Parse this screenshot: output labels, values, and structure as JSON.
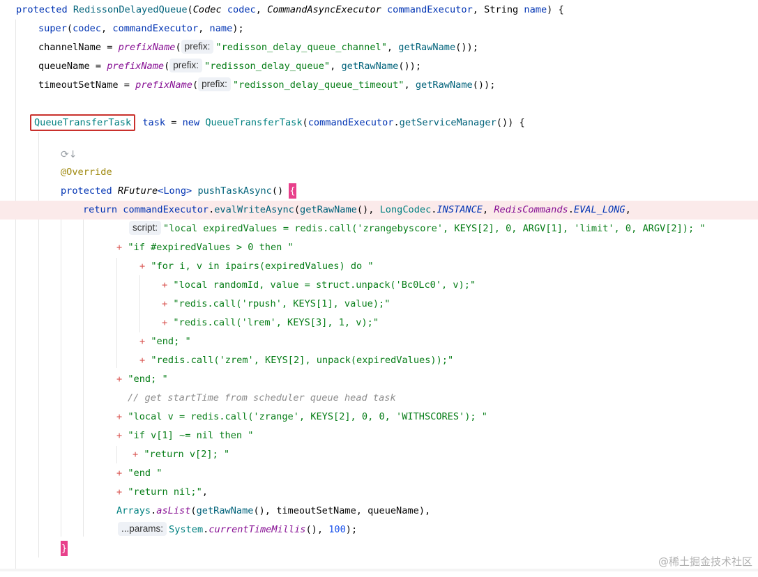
{
  "code": {
    "l1": {
      "kw": "protected ",
      "name": "RedissonDelayedQueue",
      "p1": "(",
      "t1": "Codec",
      "v1": " codec",
      "c1": ", ",
      "t2": "CommandAsyncExecutor",
      "v2": " commandExecutor",
      "c2": ", ",
      "t3": "String",
      "v3": " name",
      "tail": ") {"
    },
    "l2": {
      "kw": "super",
      "a": "(",
      "v1": "codec",
      "c1": ", ",
      "v2": "commandExecutor",
      "c2": ", ",
      "v3": "name",
      "tail": ");"
    },
    "l3": {
      "f": "channelName",
      "eq": " = ",
      "m": "prefixName",
      "p": "(",
      "hint": "prefix:",
      "s": "\"redisson_delay_queue_channel\"",
      "c": ", ",
      "m2": "getRawName",
      "tail": "());"
    },
    "l4": {
      "f": "queueName",
      "eq": " = ",
      "m": "prefixName",
      "p": "(",
      "hint": "prefix:",
      "s": "\"redisson_delay_queue\"",
      "c": ", ",
      "m2": "getRawName",
      "tail": "());"
    },
    "l5": {
      "f": "timeoutSetName",
      "eq": " = ",
      "m": "prefixName",
      "p": "(",
      "hint": "prefix:",
      "s": "\"redisson_delay_queue_timeout\"",
      "c": ", ",
      "m2": "getRawName",
      "tail": "());"
    },
    "l6": {
      "cls": "QueueTransferTask",
      "v": " task",
      "eq": " = ",
      "kw": "new ",
      "cls2": "QueueTransferTask",
      "p": "(",
      "v2": "commandExecutor",
      "dot": ".",
      "m": "getServiceManager",
      "tail": "()) {"
    },
    "l7": {
      "ann": "@Override"
    },
    "l8": {
      "kw": "protected ",
      "t": "RFuture",
      "gen": "<Long>",
      "sp": " ",
      "m": "pushTaskAsync",
      "p": "() ",
      "brace": "{"
    },
    "l9": {
      "kw": "return ",
      "v": "commandExecutor",
      "dot": ".",
      "m": "evalWriteAsync",
      "p": "(",
      "m2": "getRawName",
      "c": "(), ",
      "cls": "LongCodec",
      "dot2": ".",
      "st": "INSTANCE",
      "c2": ", ",
      "cls2": "RedisCommands",
      "dot3": ".",
      "st2": "EVAL_LONG",
      "tail": ","
    },
    "l10": {
      "hint": "script:",
      "s": "\"local expiredValues = redis.call('zrangebyscore', KEYS[2], 0, ARGV[1], 'limit', 0, ARGV[2]); \""
    },
    "l11": {
      "plus": "+ ",
      "s": "\"if #expiredValues > 0 then \""
    },
    "l12": {
      "plus": "+ ",
      "s": "\"for i, v in ipairs(expiredValues) do \""
    },
    "l13": {
      "plus": "+ ",
      "s": "\"local randomId, value = struct.unpack('Bc0Lc0', v);\""
    },
    "l14": {
      "plus": "+ ",
      "s": "\"redis.call('rpush', KEYS[1], value);\""
    },
    "l15": {
      "plus": "+ ",
      "s": "\"redis.call('lrem', KEYS[3], 1, v);\""
    },
    "l16": {
      "plus": "+ ",
      "s": "\"end; \""
    },
    "l17": {
      "plus": "+ ",
      "s": "\"redis.call('zrem', KEYS[2], unpack(expiredValues));\""
    },
    "l18": {
      "plus": "+ ",
      "s": "\"end; \""
    },
    "l19": {
      "cmt": "// get startTime from scheduler queue head task"
    },
    "l20": {
      "plus": "+ ",
      "s": "\"local v = redis.call('zrange', KEYS[2], 0, 0, 'WITHSCORES'); \""
    },
    "l21": {
      "plus": "+ ",
      "s": "\"if v[1] ~= nil then \""
    },
    "l22": {
      "plus": "+ ",
      "s": "\"return v[2]; \""
    },
    "l23": {
      "plus": "+ ",
      "s": "\"end \""
    },
    "l24": {
      "plus": "+ ",
      "s": "\"return nil;\"",
      "tail": ","
    },
    "l25": {
      "cls": "Arrays",
      "dot": ".",
      "m": "asList",
      "p": "(",
      "m2": "getRawName",
      "c": "(), ",
      "v1": "timeoutSetName",
      "c2": ", ",
      "v2": "queueName",
      "tail": "),"
    },
    "l26": {
      "hint": "...params:",
      "cls": "System",
      "dot": ".",
      "m": "currentTimeMillis",
      "p": "(), ",
      "n": "100",
      "tail": ");"
    },
    "l27": {
      "brace": "}"
    }
  },
  "gutter_icon": "run-override-icon",
  "watermark": "@稀土掘金技术社区"
}
